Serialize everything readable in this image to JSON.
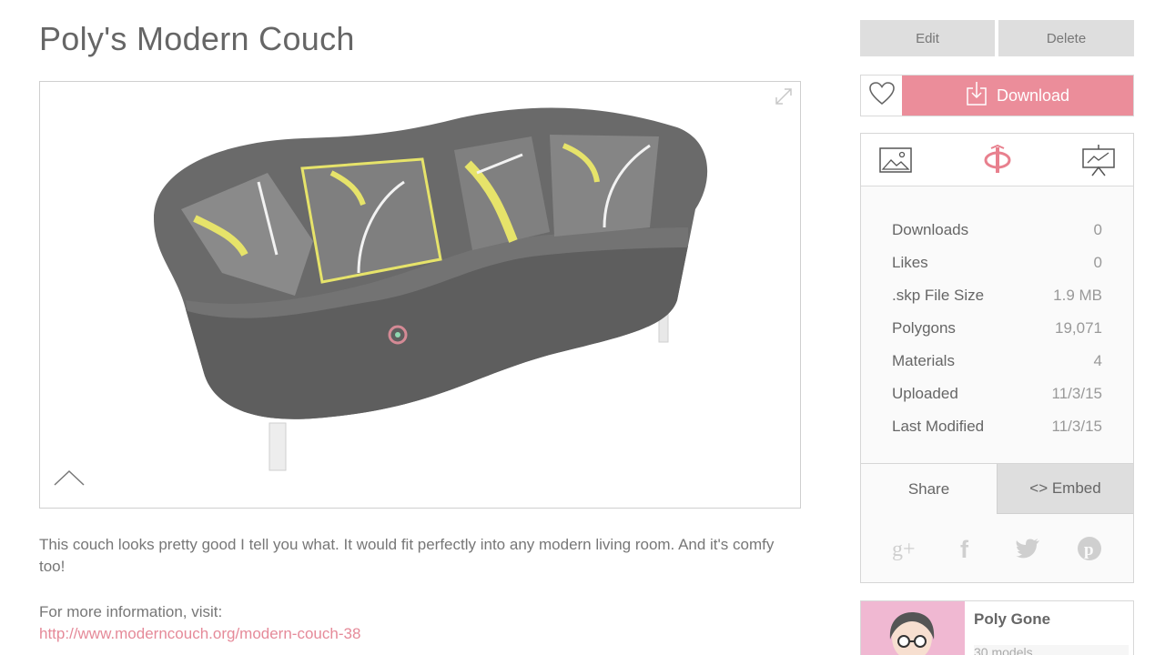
{
  "page": {
    "title": "Poly's Modern Couch",
    "description": "This couch looks pretty good I tell you what. It would fit perfectly into any modern living room. And it's comfy too!",
    "more_info_label": "For more information, visit:",
    "more_info_link": "http://www.moderncouch.org/modern-couch-38"
  },
  "actions": {
    "edit_label": "Edit",
    "delete_label": "Delete",
    "download_label": "Download"
  },
  "stats": [
    {
      "label": "Downloads",
      "value": "0"
    },
    {
      "label": "Likes",
      "value": "0"
    },
    {
      "label": ".skp File Size",
      "value": "1.9 MB"
    },
    {
      "label": "Polygons",
      "value": "19,071"
    },
    {
      "label": "Materials",
      "value": "4"
    },
    {
      "label": "Uploaded",
      "value": "11/3/15"
    },
    {
      "label": "Last Modified",
      "value": "11/3/15"
    }
  ],
  "share": {
    "share_label": "Share",
    "embed_label": "<> Embed"
  },
  "author": {
    "name": "Poly Gone",
    "models": "30 models"
  },
  "colors": {
    "accent": "#eb8d9a",
    "link": "#e58a99",
    "button_gray": "#dedede"
  },
  "icons": [
    "fullscreen-icon",
    "collapse-icon",
    "heart-icon",
    "download-icon",
    "image-icon",
    "rotate-3d-icon",
    "presentation-icon",
    "google-plus-icon",
    "facebook-icon",
    "twitter-icon",
    "pinterest-icon"
  ]
}
